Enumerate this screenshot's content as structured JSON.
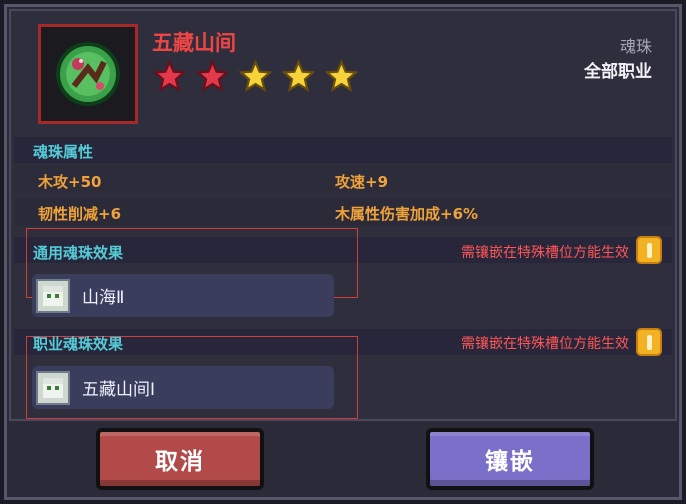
{
  "item": {
    "name": "五藏山间",
    "type_label": "魂珠",
    "class_label": "全部职业",
    "stars_total": 5,
    "stars_red": 2,
    "colors": {
      "name": "#f04545",
      "star_red": "#e23a4a",
      "star_gold": "#f5d33a"
    }
  },
  "attributes": {
    "title": "魂珠属性",
    "rows": [
      [
        "木攻+50",
        "攻速+9"
      ],
      [
        "韧性削减+6",
        "木属性伤害加成+6%"
      ]
    ]
  },
  "general_effect": {
    "title": "通用魂珠效果",
    "note": "需镶嵌在特殊槽位方能生效",
    "slot_name": "山海Ⅱ"
  },
  "class_effect": {
    "title": "职业魂珠效果",
    "note": "需镶嵌在特殊槽位方能生效",
    "slot_name": "五藏山间Ⅰ"
  },
  "buttons": {
    "cancel": "取消",
    "inlay": "镶嵌"
  }
}
